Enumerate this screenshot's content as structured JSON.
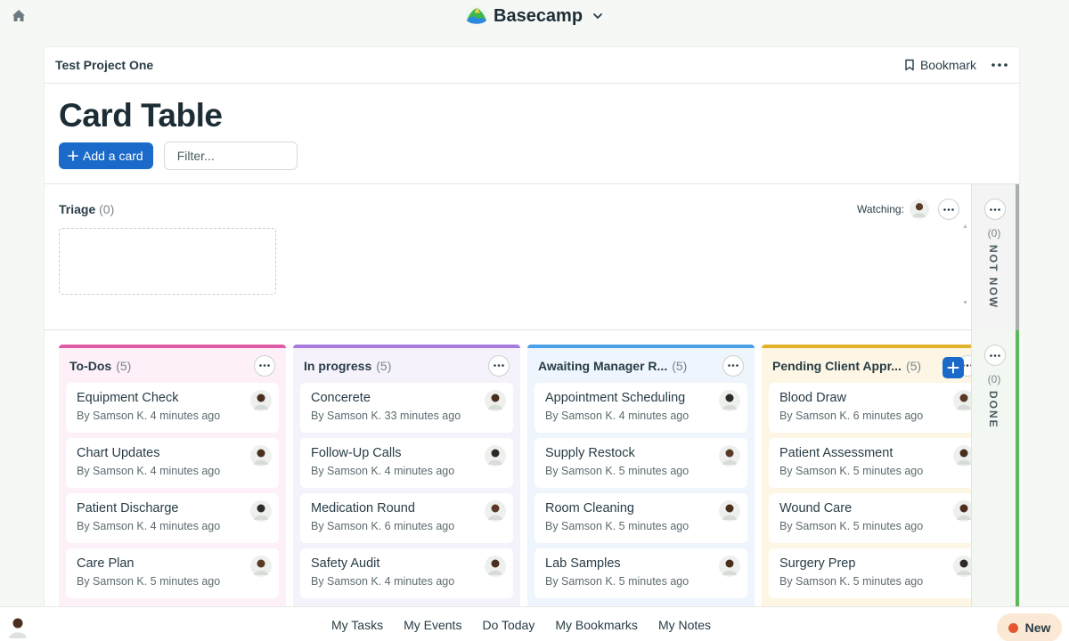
{
  "brand": {
    "name": "Basecamp"
  },
  "project": {
    "name": "Test Project One",
    "bookmark_label": "Bookmark"
  },
  "page": {
    "title": "Card Table",
    "add_card_label": "Add a card",
    "filter_placeholder": "Filter..."
  },
  "triage": {
    "title": "Triage",
    "count": "(0)",
    "watching_label": "Watching:"
  },
  "rails": {
    "not_now": {
      "count": "(0)",
      "label": "NOT NOW"
    },
    "done": {
      "count": "(0)",
      "label": "DONE"
    }
  },
  "columns": [
    {
      "title": "To-Dos",
      "count": "(5)",
      "color": "#e05ba6",
      "bg": "#fdf0f8",
      "cards": [
        {
          "title": "Equipment Check",
          "meta": "By Samson K. 4 minutes ago"
        },
        {
          "title": "Chart Updates",
          "meta": "By Samson K. 4 minutes ago"
        },
        {
          "title": "Patient Discharge",
          "meta": "By Samson K. 4 minutes ago"
        },
        {
          "title": "Care Plan",
          "meta": "By Samson K. 5 minutes ago"
        }
      ]
    },
    {
      "title": "In progress",
      "count": "(5)",
      "color": "#a77be0",
      "bg": "#f6f2fc",
      "cards": [
        {
          "title": "Concerete",
          "meta": "By Samson K. 33 minutes ago"
        },
        {
          "title": "Follow-Up Calls",
          "meta": "By Samson K. 4 minutes ago"
        },
        {
          "title": "Medication Round",
          "meta": "By Samson K. 6 minutes ago"
        },
        {
          "title": "Safety Audit",
          "meta": "By Samson K. 4 minutes ago"
        }
      ]
    },
    {
      "title": "Awaiting Manager R...",
      "count": "(5)",
      "color": "#4ba0e6",
      "bg": "#eef5fc",
      "cards": [
        {
          "title": "Appointment Scheduling",
          "meta": "By Samson K. 4 minutes ago"
        },
        {
          "title": "Supply Restock",
          "meta": "By Samson K. 5 minutes ago"
        },
        {
          "title": "Room Cleaning",
          "meta": "By Samson K. 5 minutes ago"
        },
        {
          "title": "Lab Samples",
          "meta": "By Samson K. 5 minutes ago"
        }
      ]
    },
    {
      "title": "Pending Client Appr...",
      "count": "(5)",
      "color": "#e2b32a",
      "bg": "#fdf6e4",
      "cards": [
        {
          "title": "Blood Draw",
          "meta": "By Samson K. 6 minutes ago"
        },
        {
          "title": "Patient Assessment",
          "meta": "By Samson K. 5 minutes ago"
        },
        {
          "title": "Wound Care",
          "meta": "By Samson K. 5 minutes ago"
        },
        {
          "title": "Surgery Prep",
          "meta": "By Samson K. 5 minutes ago"
        }
      ]
    }
  ],
  "bottom_nav": [
    "My Tasks",
    "My Events",
    "Do Today",
    "My Bookmarks",
    "My Notes"
  ],
  "new_label": "New",
  "icons": {
    "home": "home-icon",
    "bookmark": "bookmark-icon",
    "more": "ellipsis-icon",
    "add": "plus-icon",
    "avatar": "avatar-icon"
  }
}
